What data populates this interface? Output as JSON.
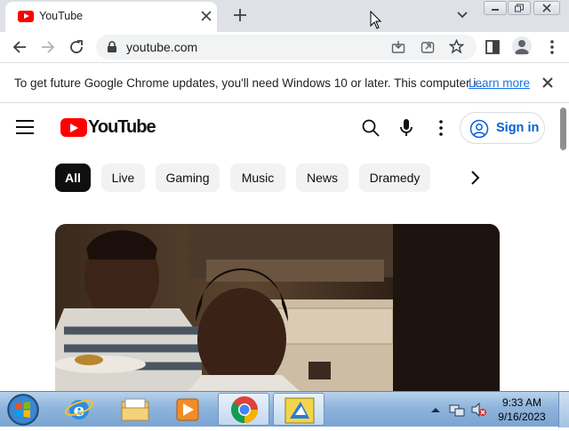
{
  "browser": {
    "tab": {
      "title": "YouTube"
    },
    "address": {
      "url": "youtube.com"
    },
    "infobar": {
      "message": "To get future Google Chrome updates, you'll need Windows 10 or later. This computer i...",
      "link": "Learn more"
    }
  },
  "youtube": {
    "logo_text": "YouTube",
    "signin_label": "Sign in",
    "chips": [
      "All",
      "Live",
      "Gaming",
      "Music",
      "News",
      "Dramedy"
    ],
    "active_chip": "All"
  },
  "taskbar": {
    "time": "9:33 AM",
    "date": "9/16/2023"
  },
  "colors": {
    "youtube_red": "#ff0000",
    "link_blue": "#1a73e8",
    "signin_blue": "#065fd4",
    "tabstrip_bg": "#dee1e6",
    "taskbar_blue": "#8fb4dc"
  },
  "icons": [
    "youtube-favicon-icon",
    "close-icon",
    "plus-icon",
    "chevron-down-icon",
    "minimize-icon",
    "maximize-icon",
    "back-arrow-icon",
    "forward-arrow-icon",
    "reload-icon",
    "lock-icon",
    "install-icon",
    "share-icon",
    "star-icon",
    "side-panel-icon",
    "profile-icon",
    "kebab-menu-icon",
    "hamburger-icon",
    "search-icon",
    "microphone-icon",
    "account-circle-icon",
    "chevron-right-icon",
    "windows-start-icon",
    "internet-explorer-icon",
    "file-explorer-icon",
    "media-player-icon",
    "chrome-icon",
    "app-icon",
    "tray-arrow-icon",
    "network-icon",
    "volume-muted-icon"
  ]
}
